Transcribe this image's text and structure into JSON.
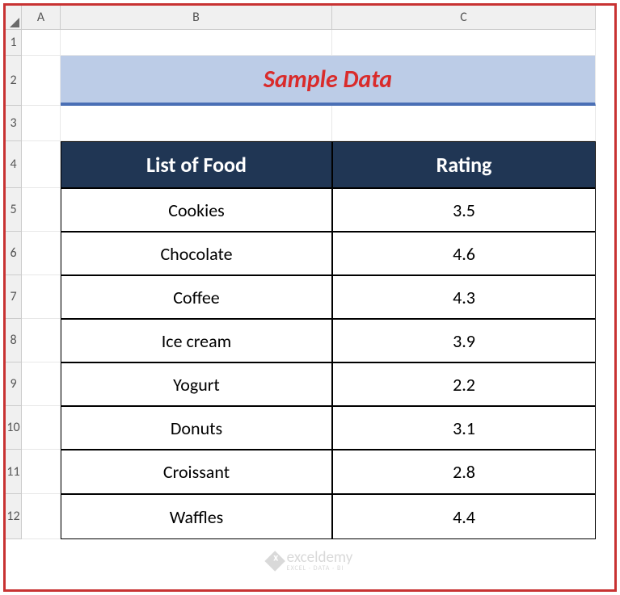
{
  "columns": {
    "a": "A",
    "b": "B",
    "c": "C"
  },
  "rows": {
    "r1": "1",
    "r2": "2",
    "r3": "3",
    "r4": "4",
    "r5": "5",
    "r6": "6",
    "r7": "7",
    "r8": "8",
    "r9": "9",
    "r10": "10",
    "r11": "11",
    "r12": "12"
  },
  "title": "Sample Data",
  "table": {
    "headers": {
      "food": "List of Food",
      "rating": "Rating"
    },
    "rows": [
      {
        "food": "Cookies",
        "rating": "3.5"
      },
      {
        "food": "Chocolate",
        "rating": "4.6"
      },
      {
        "food": "Coffee",
        "rating": "4.3"
      },
      {
        "food": "Ice cream",
        "rating": "3.9"
      },
      {
        "food": "Yogurt",
        "rating": "2.2"
      },
      {
        "food": "Donuts",
        "rating": "3.1"
      },
      {
        "food": "Croissant",
        "rating": "2.8"
      },
      {
        "food": "Waffles",
        "rating": "4.4"
      }
    ]
  },
  "watermark": {
    "brand": "exceldemy",
    "sub": "EXCEL · DATA · BI"
  }
}
